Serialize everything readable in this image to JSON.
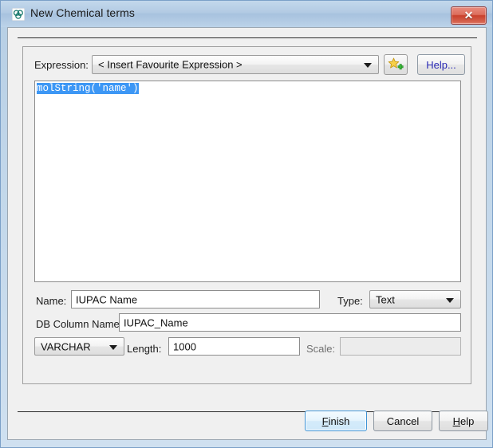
{
  "window": {
    "title": "New Chemical terms",
    "icon": "chemical-structure-icon",
    "close_label": "✕",
    "accent": "#3d97f5",
    "titlebar_color": "#b2cae3",
    "close_color": "#c9402c"
  },
  "expression_row": {
    "label": "Expression:",
    "combo_value": "< Insert Favourite Expression >",
    "favourite_icon": "add-favourite-star-icon",
    "help_label": "Help...",
    "help_color": "#2a2ab4"
  },
  "editor": {
    "content": "molString('name')",
    "selected": true,
    "selection_color": "#3d97f5"
  },
  "fields": {
    "name_label": "Name:",
    "name_value": "IUPAC Name",
    "type_label": "Type:",
    "type_value": "Text",
    "db_column_label": "DB Column Name:",
    "db_column_value": "IUPAC_Name",
    "sql_type_value": "VARCHAR",
    "length_label": "Length:",
    "length_value": "1000",
    "scale_label": "Scale:",
    "scale_value": "",
    "scale_enabled": false
  },
  "buttons": {
    "finish_pre": "F",
    "finish_mn": "",
    "finish_post": "inish",
    "finish_label": "Finish",
    "cancel_label": "Cancel",
    "help_pre": "",
    "help_post": "elp",
    "help_label": "Help"
  }
}
